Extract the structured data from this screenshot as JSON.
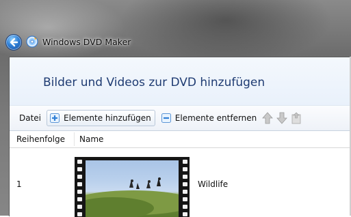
{
  "window": {
    "title": "Windows DVD Maker",
    "back_icon": "back-arrow-icon",
    "app_icon": "dvd-maker-icon"
  },
  "header": {
    "title": "Bilder und Videos zur DVD hinzufügen"
  },
  "toolbar": {
    "file_label": "Datei",
    "add_label": "Elemente hinzufügen",
    "remove_label": "Elemente entfernen",
    "icons": [
      "add-items-icon",
      "remove-items-icon",
      "move-up-icon",
      "move-down-icon",
      "disc-options-icon"
    ]
  },
  "table": {
    "columns": [
      "Reihenfolge",
      "Name"
    ],
    "rows": [
      {
        "order": "1",
        "name": "Wildlife",
        "thumbnail": "video-thumbnail"
      }
    ]
  },
  "colors": {
    "title_text": "#1e3b72",
    "header_band": "#eef4fb",
    "accent_blue": "#2f7fd6"
  }
}
